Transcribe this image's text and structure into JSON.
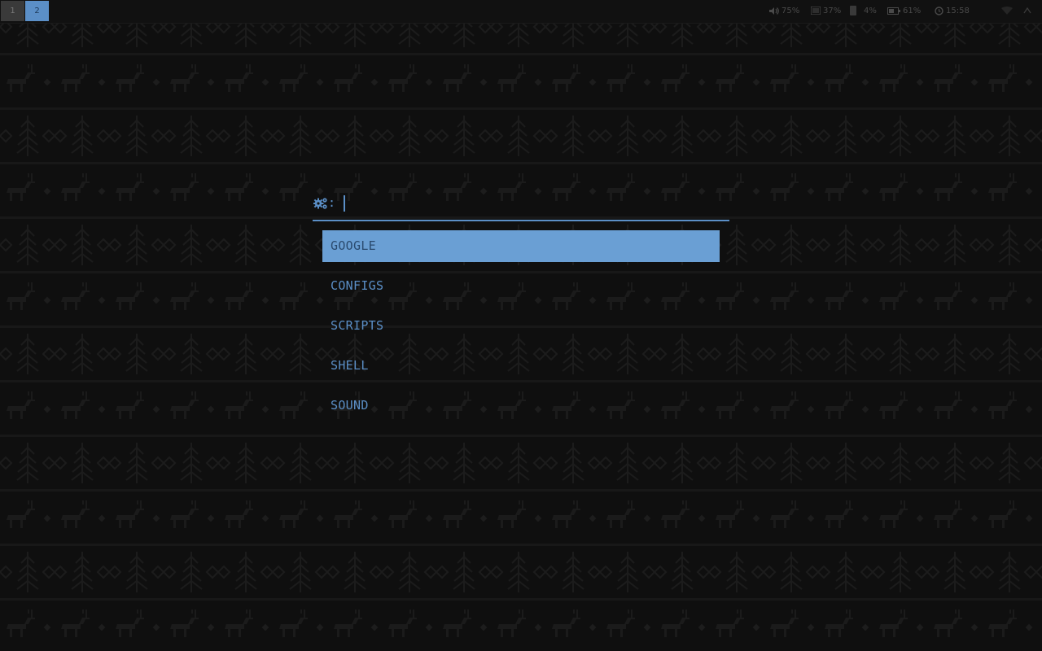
{
  "workspaces": [
    {
      "label": "1"
    },
    {
      "label": "2"
    }
  ],
  "status": {
    "volume": "75%",
    "memory": "37%",
    "disk": "4%",
    "battery": "61%",
    "clock": "15:58"
  },
  "launcher": {
    "prompt_icon": "gears-icon",
    "prompt_suffix": ":",
    "query": "",
    "items": [
      {
        "label": "GOOGLE",
        "selected": true
      },
      {
        "label": "CONFIGS",
        "selected": false
      },
      {
        "label": "SCRIPTS",
        "selected": false
      },
      {
        "label": "SHELL",
        "selected": false
      },
      {
        "label": "SOUND",
        "selected": false
      }
    ]
  },
  "colors": {
    "accent": "#5b8fc7",
    "selected_bg": "#6a9fd4",
    "background": "#0f0f0f"
  }
}
